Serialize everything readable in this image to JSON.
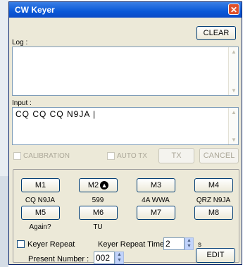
{
  "window": {
    "title": "CW Keyer",
    "close_glyph": "✕"
  },
  "toolbar": {
    "clear_label": "CLEAR"
  },
  "log": {
    "label": "Log :",
    "value": ""
  },
  "input": {
    "label": "Input :",
    "value": "CQ CQ CQ N9JA |"
  },
  "options": {
    "calibration_label": "CALIBRATION",
    "auto_tx_label": "AUTO TX",
    "tx_label": "TX",
    "cancel_label": "CANCEL"
  },
  "macros": [
    {
      "button": "M1",
      "text": "CQ N9JA"
    },
    {
      "button": "M2",
      "text": "599",
      "icon": "arrow-up-icon"
    },
    {
      "button": "M3",
      "text": "4A WWA"
    },
    {
      "button": "M4",
      "text": "QRZ N9JA"
    },
    {
      "button": "M5",
      "text": "Again?"
    },
    {
      "button": "M6",
      "text": "TU"
    },
    {
      "button": "M7",
      "text": ""
    },
    {
      "button": "M8",
      "text": ""
    }
  ],
  "repeat": {
    "keyer_repeat_label": "Keyer Repeat",
    "repeat_time_label": "Keyer Repeat Time :",
    "repeat_time_value": "2",
    "repeat_unit": "s"
  },
  "present": {
    "label": "Present Number :",
    "value": "002"
  },
  "edit_label": "EDIT"
}
